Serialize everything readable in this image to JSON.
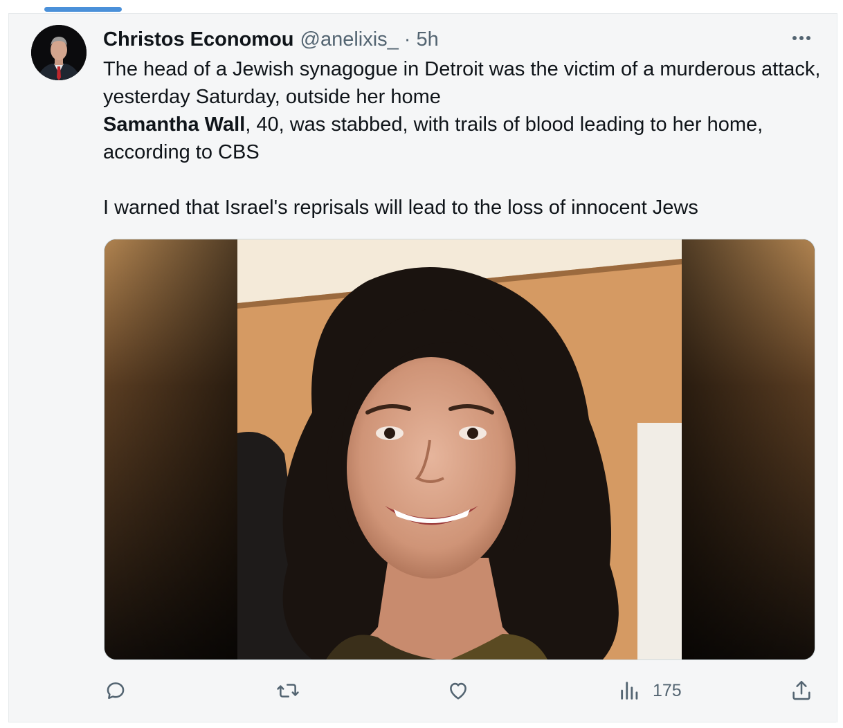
{
  "tweet": {
    "author": {
      "display_name": "Christos Economou",
      "handle": "@anelixis_",
      "separator": "·",
      "time": "5h"
    },
    "text": {
      "line1": "The head of a Jewish synagogue in Detroit was the victim of a murderous attack, yesterday Saturday, outside her home",
      "name_bold": "Samantha Wall",
      "line2_rest": ", 40, was stabbed, with trails of blood leading to her home, according to CBS",
      "line3": "I warned that Israel's reprisals will lead to the loss of innocent Jews"
    },
    "media": {
      "icon": "photo-of-woman-with-curly-hair"
    },
    "actions": {
      "reply_icon": "reply-icon",
      "retweet_icon": "retweet-icon",
      "like_icon": "like-icon",
      "views_icon": "views-icon",
      "views_count": "175",
      "share_icon": "share-icon"
    }
  },
  "colors": {
    "card_background": "#f5f6f7",
    "text_primary": "#0f1419",
    "text_secondary": "#536471",
    "progress_accent": "#4a90d9"
  }
}
